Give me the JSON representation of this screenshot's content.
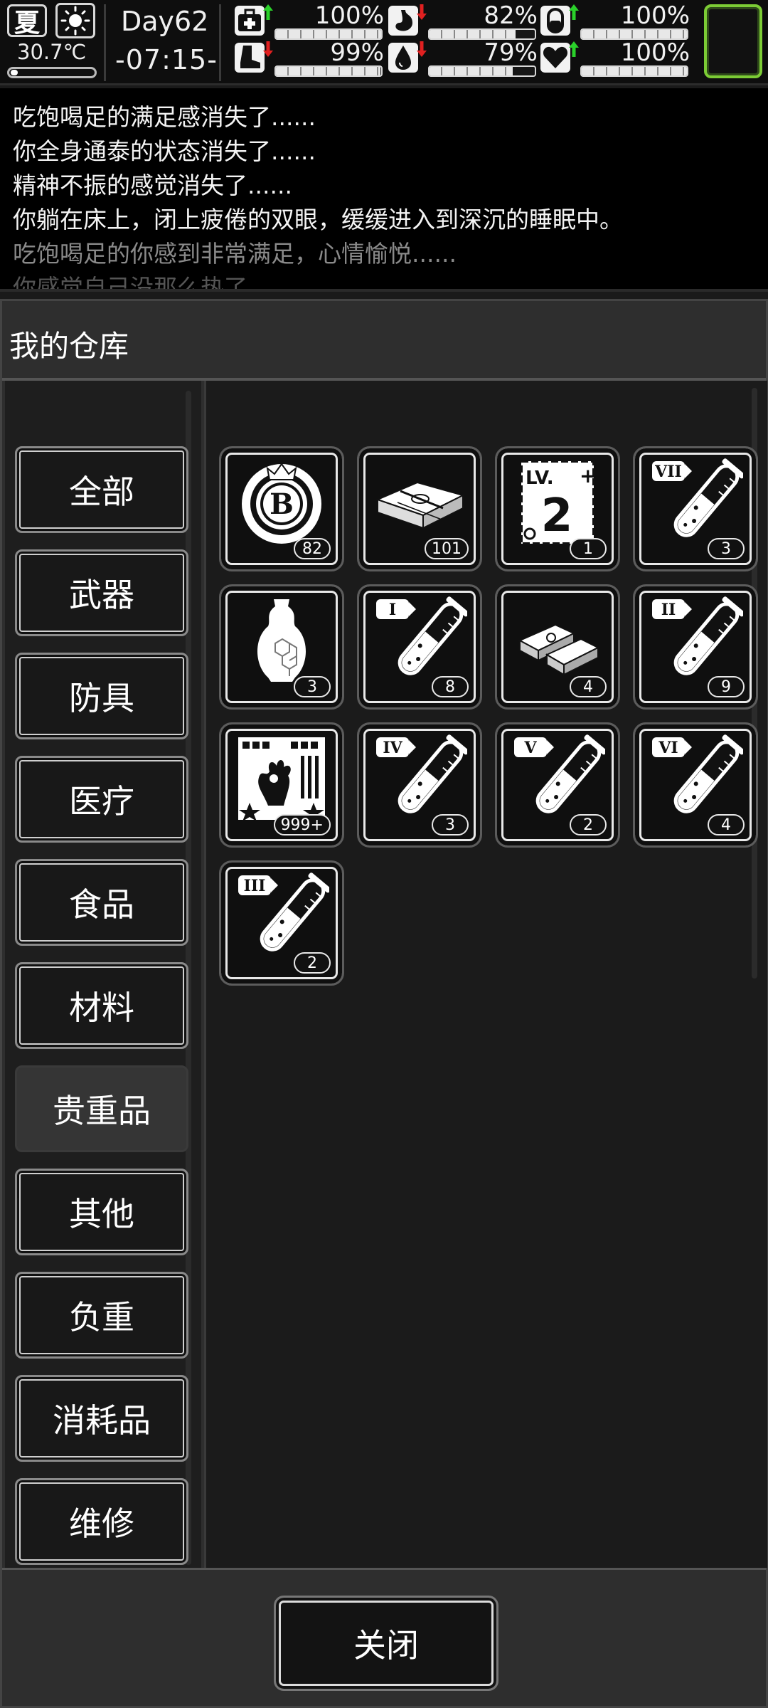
{
  "status": {
    "season": "夏",
    "weather_icon": "sun-icon",
    "temperature": "30.7℃",
    "temperature_level": 0.05,
    "day": "Day62",
    "time": "-07:15-",
    "stats": [
      {
        "name": "health",
        "icon": "medkit-icon",
        "trend": "up",
        "value": "100%",
        "level": 1.0
      },
      {
        "name": "hunger",
        "icon": "stomach-icon",
        "trend": "down",
        "value": "82%",
        "level": 0.82
      },
      {
        "name": "medicine",
        "icon": "pill-icon",
        "trend": "up",
        "value": "100%",
        "level": 1.0
      },
      {
        "name": "stamina",
        "icon": "boot-icon",
        "trend": "down",
        "value": "99%",
        "level": 0.99
      },
      {
        "name": "thirst",
        "icon": "water-drop-icon",
        "trend": "down",
        "value": "79%",
        "level": 0.79
      },
      {
        "name": "mood",
        "icon": "heart-icon",
        "trend": "up",
        "value": "100%",
        "level": 1.0
      }
    ]
  },
  "log": [
    "吃饱喝足的满足感消失了......",
    "你全身通泰的状态消失了......",
    "精神不振的感觉消失了......",
    "你躺在床上，闭上疲倦的双眼，缓缓进入到深沉的睡眠中。",
    "吃饱喝足的你感到非常满足，心情愉悦......",
    "你感觉自己没那么热了......"
  ],
  "warehouse": {
    "title": "我的仓库",
    "categories": [
      "全部",
      "武器",
      "防具",
      "医疗",
      "食品",
      "材料",
      "贵重品",
      "其他",
      "负重",
      "消耗品",
      "维修"
    ],
    "active_category": "贵重品",
    "items": [
      {
        "icon": "casino-chip-icon",
        "count": "82"
      },
      {
        "icon": "cash-bundle-icon",
        "count": "101"
      },
      {
        "icon": "level-card-icon",
        "count": "1"
      },
      {
        "icon": "test-tube-vii-icon",
        "count": "3"
      },
      {
        "icon": "porcelain-vase-icon",
        "count": "3"
      },
      {
        "icon": "test-tube-i-icon",
        "count": "8"
      },
      {
        "icon": "gold-bars-icon",
        "count": "4"
      },
      {
        "icon": "test-tube-ii-icon",
        "count": "9"
      },
      {
        "icon": "zombie-card-icon",
        "count": "999+"
      },
      {
        "icon": "test-tube-iv-icon",
        "count": "3"
      },
      {
        "icon": "test-tube-v-icon",
        "count": "2"
      },
      {
        "icon": "test-tube-vi-icon",
        "count": "4"
      },
      {
        "icon": "test-tube-iii-icon",
        "count": "2"
      }
    ],
    "close_label": "关闭"
  }
}
